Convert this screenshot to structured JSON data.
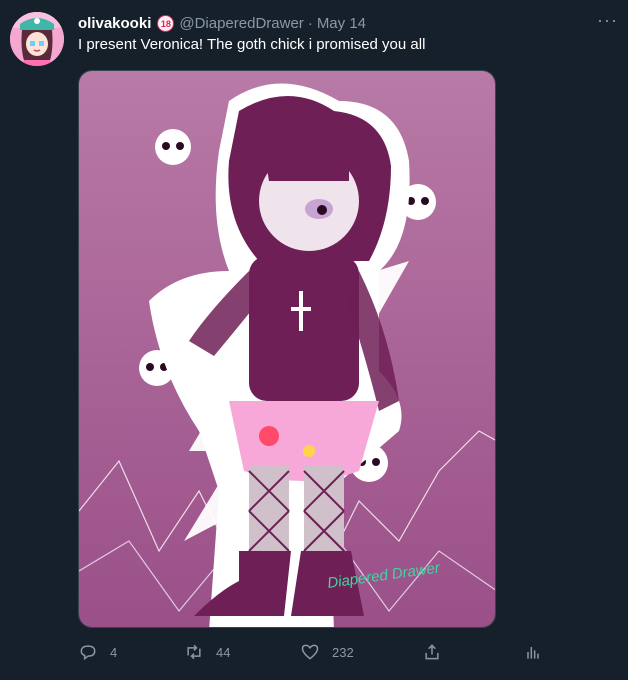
{
  "tweet": {
    "display_name": "olivakooki",
    "age_badge": "18",
    "handle": "@DiaperedDrawer",
    "separator": "·",
    "date": "May 14",
    "more_label": "···",
    "text": "I present Veronica! The goth chick i promised you all",
    "image_signature": "Diapered Drawer"
  },
  "actions": {
    "reply_count": "4",
    "retweet_count": "44",
    "like_count": "232"
  },
  "icons": {
    "reply": "reply-icon",
    "retweet": "retweet-icon",
    "like": "heart-icon",
    "share": "share-icon",
    "analytics": "analytics-icon",
    "more": "more-icon"
  },
  "colors": {
    "background": "#15202b",
    "muted": "#8899a6",
    "badge": "#e0245e",
    "art_background": "#b06e9e",
    "art_dark": "#6e1f55"
  }
}
